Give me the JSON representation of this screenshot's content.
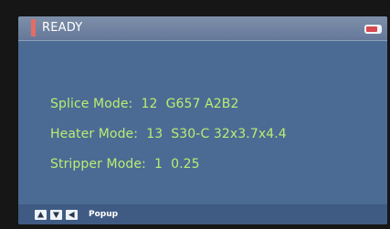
{
  "status": {
    "title": "READY",
    "marker_color": "#e36d64",
    "battery_icon": "battery-icon",
    "battery_fill_color": "#d64a4f"
  },
  "modes": {
    "splice": "Splice Mode:  12  G657 A2B2",
    "heater": "Heater Mode:  13  S30-C 32x3.7x4.4",
    "stripper": "Stripper Mode:  1  0.25"
  },
  "footer": {
    "keys": [
      "up-arrow-icon",
      "down-arrow-icon",
      "left-arrow-icon"
    ],
    "popup_label": "Popup"
  },
  "colors": {
    "screen_bg": "#4b6b95",
    "text_accent": "#b8ee72"
  }
}
